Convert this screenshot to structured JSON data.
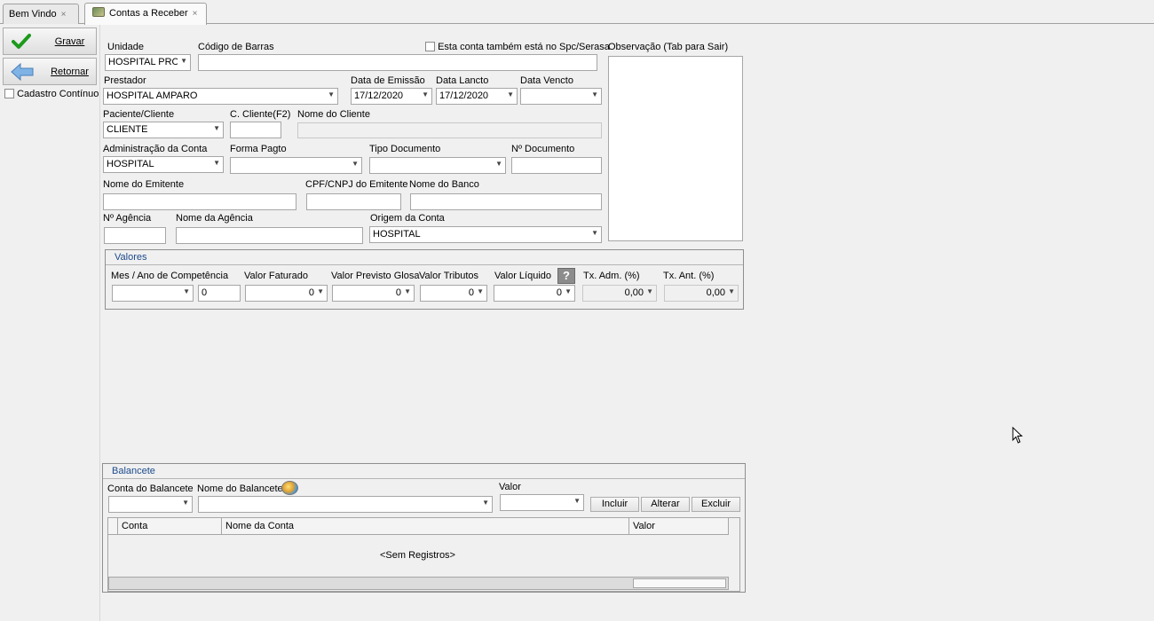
{
  "tabs": [
    {
      "label": "Bem Vindo",
      "close": "×"
    },
    {
      "label": "Contas a Receber",
      "close": "×"
    }
  ],
  "toolbar": {
    "save": "Gravar",
    "back": "Retornar",
    "continuous": "Cadastro Contínuo"
  },
  "form": {
    "unidade": {
      "label": "Unidade",
      "value": "HOSPITAL PROI"
    },
    "codigo_barras": {
      "label": "Código de Barras",
      "value": ""
    },
    "spc": {
      "label": "Esta conta também está no Spc/Serasa"
    },
    "observacao": {
      "label": "Observação (Tab para Sair)",
      "value": ""
    },
    "prestador": {
      "label": "Prestador",
      "value": "HOSPITAL AMPARO"
    },
    "data_emissao": {
      "label": "Data de Emissão",
      "value": "17/12/2020"
    },
    "data_lancto": {
      "label": "Data Lancto",
      "value": "17/12/2020"
    },
    "data_vencto": {
      "label": "Data Vencto",
      "value": ""
    },
    "paciente": {
      "label": "Paciente/Cliente",
      "value": "CLIENTE"
    },
    "c_cliente": {
      "label": "C. Cliente(F2)",
      "value": ""
    },
    "nome_cliente": {
      "label": "Nome do Cliente",
      "value": ""
    },
    "adm_conta": {
      "label": "Administração da Conta",
      "value": "HOSPITAL"
    },
    "forma_pagto": {
      "label": "Forma Pagto",
      "value": ""
    },
    "tipo_documento": {
      "label": "Tipo Documento",
      "value": ""
    },
    "num_documento": {
      "label": "Nº Documento",
      "value": ""
    },
    "nome_emitente": {
      "label": "Nome do Emitente",
      "value": ""
    },
    "cpf_emitente": {
      "label": "CPF/CNPJ do Emitente",
      "value": ""
    },
    "nome_banco": {
      "label": "Nome do Banco",
      "value": ""
    },
    "num_agencia": {
      "label": "Nº Agência",
      "value": ""
    },
    "nome_agencia": {
      "label": "Nome da Agência",
      "value": ""
    },
    "origem_conta": {
      "label": "Origem da Conta",
      "value": "HOSPITAL"
    }
  },
  "valores": {
    "title": "Valores",
    "competencia": {
      "label": "Mes / Ano de Competência",
      "month": "",
      "year": "0"
    },
    "faturado": {
      "label": "Valor Faturado",
      "value": "0"
    },
    "glosa": {
      "label": "Valor Previsto Glosa",
      "value": "0"
    },
    "tributos": {
      "label": "Valor Tributos",
      "value": "0"
    },
    "liquido": {
      "label": "Valor Líquido",
      "value": "0",
      "help": "?"
    },
    "tx_adm": {
      "label": "Tx. Adm. (%)",
      "value": "0,00"
    },
    "tx_ant": {
      "label": "Tx. Ant. (%)",
      "value": "0,00"
    }
  },
  "balancete": {
    "title": "Balancete",
    "conta_label": "Conta do Balancete",
    "nome_label": "Nome do Balancete",
    "valor_label": "Valor",
    "buttons": {
      "incluir": "Incluir",
      "alterar": "Alterar",
      "excluir": "Excluir"
    },
    "columns": [
      "Conta",
      "Nome da Conta",
      "Valor"
    ],
    "empty": "<Sem Registros>"
  }
}
